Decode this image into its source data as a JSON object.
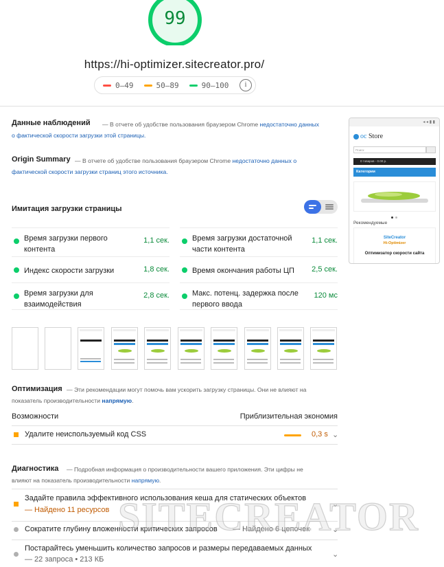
{
  "gauge": {
    "score": "99",
    "fraction": 0.99,
    "color": "#0cce6b"
  },
  "url": "https://hi-optimizer.sitecreator.pro/",
  "legend": [
    {
      "range": "0–49",
      "color": "#ff4e42"
    },
    {
      "range": "50–89",
      "color": "#ffa400"
    },
    {
      "range": "90–100",
      "color": "#0cce6b"
    }
  ],
  "legend_info_icon": "i",
  "field_data": {
    "title": "Данные наблюдений",
    "desc": "— В отчете об удобстве пользования браузером Chrome ",
    "link": "недостаточно данных о фактической скорости загрузки этой страницы."
  },
  "origin_summary": {
    "title": "Origin Summary",
    "desc": "— В отчете об удобстве пользования браузером Chrome ",
    "link": "недостаточно данных о фактической скорости загрузки страниц этого источника."
  },
  "lab": {
    "title": "Имитация загрузки страницы"
  },
  "metrics": [
    {
      "label": "Время загрузки первого контента",
      "value": "1,1 сек."
    },
    {
      "label": "Время загрузки достаточной части контента",
      "value": "1,1 сек."
    },
    {
      "label": "Индекс скорости загрузки",
      "value": "1,8 сек."
    },
    {
      "label": "Время окончания работы ЦП",
      "value": "2,5 сек."
    },
    {
      "label": "Время загрузки для взаимодействия",
      "value": "2,8 сек."
    },
    {
      "label": "Макс. потенц. задержка после первого ввода",
      "value": "120 мс"
    }
  ],
  "optimization": {
    "title": "Оптимизация",
    "desc": "— Эти рекомендации могут помочь вам ускорить загрузку страницы. Они не влияют на показатель производительности ",
    "link": "напрямую",
    "col_left": "Возможности",
    "col_right": "Приблизительная экономия",
    "item": {
      "label": "Удалите неиспользуемый код CSS",
      "value": "0,3 s",
      "color": "#ffa400"
    }
  },
  "diagnostics": {
    "title": "Диагностика",
    "desc": "— Подробная информация о производительности вашего приложения. Эти цифры не влияют на показатель производительности ",
    "link": "напрямую",
    "items": [
      {
        "label": "Задайте правила эффективного использования кеша для статических объектов",
        "detail": "— Найдено 11 ресурсов",
        "color": "#ffa400"
      },
      {
        "label": "Сократите глубину вложенности критических запросов",
        "detail": "— Найдено 6 цепочек",
        "color": "#b0b0b0"
      },
      {
        "label": "Постарайтесь уменьшить количество запросов и размеры передаваемых данных",
        "detail": "— 22 запроса • 213 КБ",
        "color": "#b0b0b0"
      }
    ]
  },
  "phone": {
    "status": "◂ ◂ ▮ ▮",
    "logo_a": "oc ",
    "logo_b": "Store",
    "search": "Поиск",
    "cart": "0 товаров - 0.00 р.",
    "category": "Категории",
    "recommended": "Рекомендуемые",
    "card_1": "SiteCreator",
    "card_2": "Hi-Optimizer",
    "card_3": "Оптимизатор скорости сайта"
  },
  "watermark": "SITECREATOR"
}
